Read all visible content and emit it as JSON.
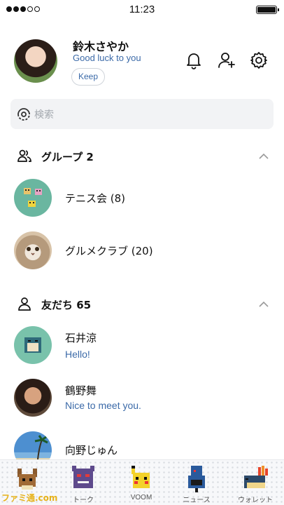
{
  "status_bar": {
    "time": "11:23"
  },
  "profile": {
    "name": "鈴木さやか",
    "status_message": "Good luck to you",
    "keep_label": "Keep"
  },
  "search": {
    "placeholder": "検索"
  },
  "groups": {
    "header": "グループ 2",
    "items": [
      {
        "name": "テニス会 (8)"
      },
      {
        "name": "グルメクラブ (20)"
      }
    ]
  },
  "friends": {
    "header": "友だち 65",
    "items": [
      {
        "name": "石井涼",
        "status": "Hello!"
      },
      {
        "name": "鶴野舞",
        "status": "Nice to meet you."
      },
      {
        "name": "向野じゅん"
      }
    ]
  },
  "tabbar": {
    "tabs": [
      {
        "label": ""
      },
      {
        "label": "トーク"
      },
      {
        "label": "VOOM"
      },
      {
        "label": "ニュース"
      },
      {
        "label": "ウォレット"
      }
    ]
  },
  "watermark": "ファミ通.com",
  "colors": {
    "accent_blue": "#3b6aa8",
    "search_bg": "#f2f3f5"
  },
  "icons": [
    "bell-icon",
    "add-friend-icon",
    "gear-icon",
    "search-icon",
    "group-icon",
    "person-icon",
    "chevron-up-icon"
  ]
}
